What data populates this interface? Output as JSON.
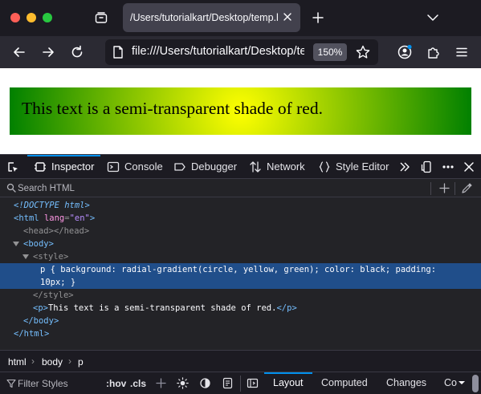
{
  "browser": {
    "tab_title": "/Users/tutorialkart/Desktop/temp.html",
    "url": "file:///Users/tutorialkart/Desktop/temp.html",
    "zoom": "150%"
  },
  "page": {
    "paragraph_text": "This text is a semi-transparent shade of red."
  },
  "devtools": {
    "tabs": [
      {
        "label": "Inspector"
      },
      {
        "label": "Console"
      },
      {
        "label": "Debugger"
      },
      {
        "label": "Network"
      },
      {
        "label": "Style Editor"
      }
    ],
    "search_placeholder": "Search HTML",
    "markup": {
      "doctype": "<!DOCTYPE html>",
      "html_tag": "html",
      "lang_attr": "lang",
      "lang_value": "\"en\"",
      "head": "head",
      "body": "body",
      "style": "style",
      "css_line1": "p { background: radial-gradient(circle, yellow, green); color: black; padding:",
      "css_line2": "10px; }",
      "p_tag": "p",
      "p_text": "This text is a semi-transparent shade of red."
    },
    "breadcrumbs": [
      "html",
      "body",
      "p"
    ],
    "filter_placeholder": "Filter Styles",
    "hov": ":hov",
    "cls": ".cls",
    "side_tabs": [
      {
        "label": "Layout"
      },
      {
        "label": "Computed"
      },
      {
        "label": "Changes"
      },
      {
        "label": "Co"
      }
    ]
  },
  "colors": {
    "accent": "#0090ed",
    "selection": "#204e8a",
    "tag": "#75bfff",
    "attribute": "#ff97e5",
    "attribute_value": "#b98eff"
  }
}
